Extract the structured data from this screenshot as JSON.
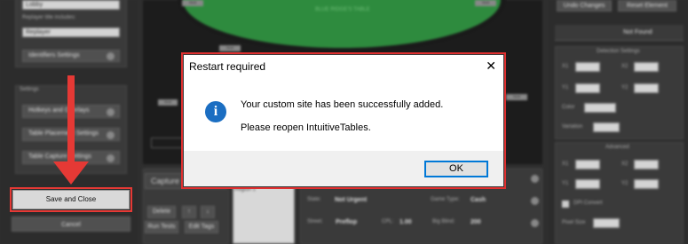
{
  "left": {
    "field1_value": "Lobby",
    "replayer_label": "Replayer title includes:",
    "replayer_value": "Replayer",
    "identifiers_button": "Identifiers Settings",
    "settings_title": "Settings",
    "settings_items": [
      {
        "label": "Hotkeys and Overlays"
      },
      {
        "label": "Table Placement Settings"
      },
      {
        "label": "Table Capture Settings"
      }
    ],
    "save_close": "Save and Close",
    "cancel": "Cancel"
  },
  "center": {
    "table_text": "BLUE RIDGE'S TABLE",
    "seats": [
      "Seat",
      "Seat",
      "Seat",
      "Seat",
      "Seat"
    ],
    "capture_label": "Capture T",
    "delete_btn": "Delete",
    "up_btn": "↑",
    "down_btn": "↓",
    "run_tests_btn": "Run Tests",
    "edit_tags_btn": "Edit Tags",
    "region_label": "Region 1",
    "state_label": "State:",
    "state_value": "Not Urgent",
    "game_type_label": "Game Type:",
    "game_type_value": "Cash",
    "street_label": "Street:",
    "street_value": "Preflop",
    "cpl_label": "CPL:",
    "cpl_value": "1.00",
    "big_blind_label": "Big Blind:",
    "big_blind_value": "200"
  },
  "right": {
    "undo_btn": "Undo Changes",
    "reset_btn": "Reset Element",
    "status": "Not Found",
    "detection_title": "Detection Settings",
    "x1": "X1",
    "x2": "X2",
    "y1": "Y1",
    "y2": "Y2",
    "color_label": "Color",
    "variation_label": "Variation",
    "advanced_title": "Advanced",
    "dpi_convert": "DPI Convert",
    "pixel_size": "Pixel Size"
  },
  "dialog": {
    "title": "Restart required",
    "close": "✕",
    "message1": "Your custom site has been successfully added.",
    "message2": "Please reopen IntuitiveTables.",
    "ok": "OK",
    "info_glyph": "i"
  }
}
